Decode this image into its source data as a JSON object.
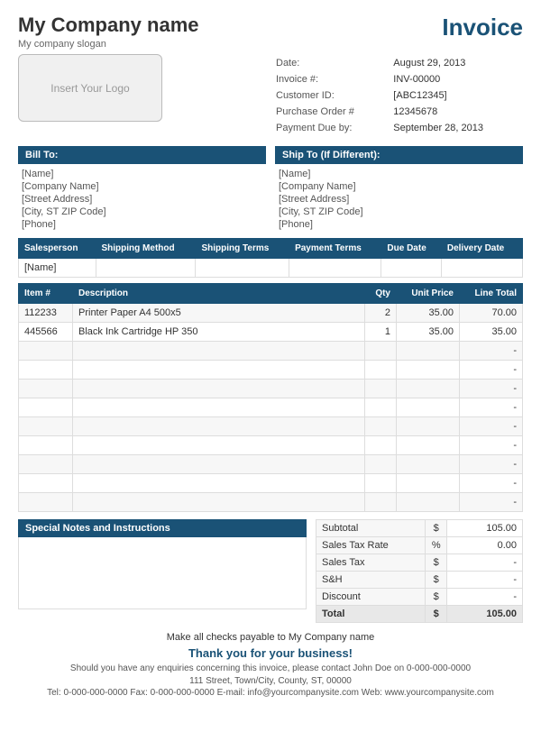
{
  "company": {
    "name": "My Company name",
    "slogan": "My company slogan",
    "logo_placeholder": "Insert Your Logo"
  },
  "invoice_title": "Invoice",
  "meta": {
    "date_label": "Date:",
    "date_value": "August 29, 2013",
    "invoice_num_label": "Invoice #:",
    "invoice_num_value": "INV-00000",
    "customer_id_label": "Customer ID:",
    "customer_id_value": "[ABC12345]",
    "purchase_order_label": "Purchase Order #",
    "purchase_order_value": "12345678",
    "payment_due_label": "Payment Due by:",
    "payment_due_value": "September 28, 2013"
  },
  "bill_to": {
    "header": "Bill To:",
    "lines": [
      "[Name]",
      "[Company Name]",
      "[Street Address]",
      "[City, ST  ZIP Code]",
      "[Phone]"
    ]
  },
  "ship_to": {
    "header": "Ship To (If Different):",
    "lines": [
      "[Name]",
      "[Company Name]",
      "[Street Address]",
      "[City, ST  ZIP Code]",
      "[Phone]"
    ]
  },
  "order_info": {
    "columns": [
      "Salesperson",
      "Shipping Method",
      "Shipping Terms",
      "Payment Terms",
      "Due Date",
      "Delivery Date"
    ],
    "row": [
      "[Name]",
      "",
      "",
      "",
      "",
      ""
    ]
  },
  "items": {
    "columns": [
      "Item #",
      "Description",
      "Qty",
      "Unit Price",
      "Line Total"
    ],
    "rows": [
      {
        "item": "112233",
        "description": "Printer Paper A4 500x5",
        "qty": "2",
        "unit_price": "35.00",
        "line_total": "70.00"
      },
      {
        "item": "445566",
        "description": "Black Ink Cartridge HP 350",
        "qty": "1",
        "unit_price": "35.00",
        "line_total": "35.00"
      },
      {
        "item": "",
        "description": "",
        "qty": "",
        "unit_price": "",
        "line_total": "-"
      },
      {
        "item": "",
        "description": "",
        "qty": "",
        "unit_price": "",
        "line_total": "-"
      },
      {
        "item": "",
        "description": "",
        "qty": "",
        "unit_price": "",
        "line_total": "-"
      },
      {
        "item": "",
        "description": "",
        "qty": "",
        "unit_price": "",
        "line_total": "-"
      },
      {
        "item": "",
        "description": "",
        "qty": "",
        "unit_price": "",
        "line_total": "-"
      },
      {
        "item": "",
        "description": "",
        "qty": "",
        "unit_price": "",
        "line_total": "-"
      },
      {
        "item": "",
        "description": "",
        "qty": "",
        "unit_price": "",
        "line_total": "-"
      },
      {
        "item": "",
        "description": "",
        "qty": "",
        "unit_price": "",
        "line_total": "-"
      },
      {
        "item": "",
        "description": "",
        "qty": "",
        "unit_price": "",
        "line_total": "-"
      }
    ]
  },
  "notes": {
    "header": "Special Notes and Instructions"
  },
  "totals": {
    "subtotal_label": "Subtotal",
    "subtotal_symbol": "$",
    "subtotal_value": "105.00",
    "tax_rate_label": "Sales Tax Rate",
    "tax_rate_symbol": "%",
    "tax_rate_value": "0.00",
    "sales_tax_label": "Sales Tax",
    "sales_tax_symbol": "$",
    "sales_tax_value": "-",
    "sh_label": "S&H",
    "sh_symbol": "$",
    "sh_value": "-",
    "discount_label": "Discount",
    "discount_symbol": "$",
    "discount_value": "-",
    "total_label": "Total",
    "total_symbol": "$",
    "total_value": "105.00"
  },
  "footer": {
    "payable_line": "Make all checks payable to My Company name",
    "thank_you": "Thank you for your business!",
    "enquiry": "Should you have any enquiries concerning this invoice, please contact John Doe on 0-000-000-0000",
    "address": "111 Street, Town/City, County, ST, 00000",
    "contact": "Tel: 0-000-000-0000  Fax: 0-000-000-0000  E-mail: info@yourcompanysite.com  Web: www.yourcompanysite.com"
  }
}
